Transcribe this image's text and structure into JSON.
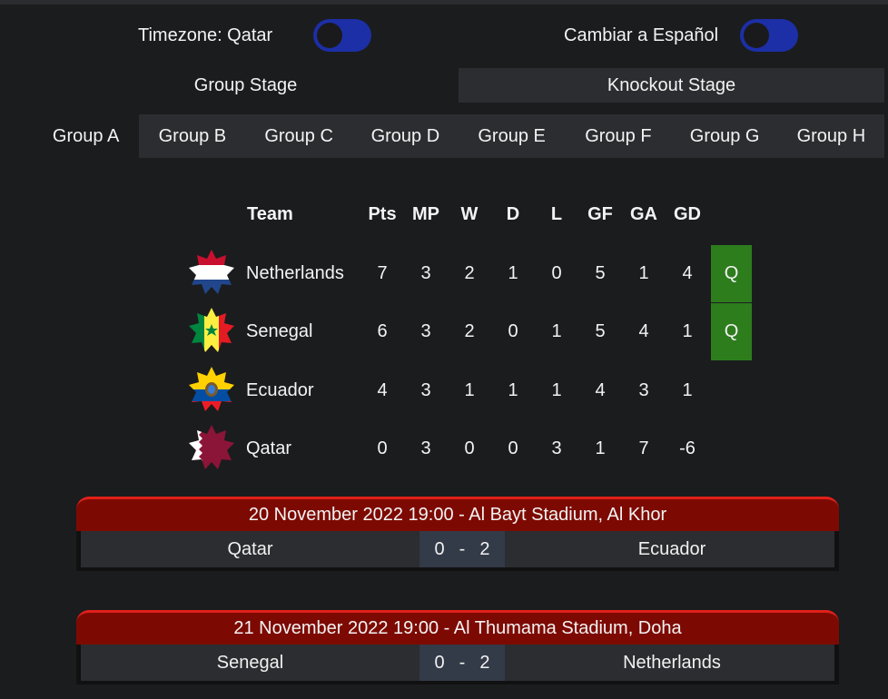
{
  "settings": {
    "timezone_label": "Timezone: Qatar",
    "language_label": "Cambiar a Español"
  },
  "stage_tabs": [
    "Group Stage",
    "Knockout Stage"
  ],
  "group_tabs": [
    "Group A",
    "Group B",
    "Group C",
    "Group D",
    "Group E",
    "Group F",
    "Group G",
    "Group H"
  ],
  "table": {
    "headers": [
      "Team",
      "Pts",
      "MP",
      "W",
      "D",
      "L",
      "GF",
      "GA",
      "GD"
    ],
    "rows": [
      {
        "team": "Netherlands",
        "stats": [
          "7",
          "3",
          "2",
          "1",
          "0",
          "5",
          "1",
          "4"
        ],
        "status": "Q"
      },
      {
        "team": "Senegal",
        "stats": [
          "6",
          "3",
          "2",
          "0",
          "1",
          "5",
          "4",
          "1"
        ],
        "status": "Q"
      },
      {
        "team": "Ecuador",
        "stats": [
          "4",
          "3",
          "1",
          "1",
          "1",
          "4",
          "3",
          "1"
        ],
        "status": ""
      },
      {
        "team": "Qatar",
        "stats": [
          "0",
          "3",
          "0",
          "0",
          "3",
          "1",
          "7",
          "-6"
        ],
        "status": ""
      }
    ]
  },
  "matches": [
    {
      "header": "20 November 2022 19:00 - Al Bayt Stadium, Al Khor",
      "home": "Qatar",
      "home_score": "0",
      "separator": "-",
      "away_score": "2",
      "away": "Ecuador"
    },
    {
      "header": "21 November 2022 19:00 - Al Thumama Stadium, Doha",
      "home": "Senegal",
      "home_score": "0",
      "separator": "-",
      "away_score": "2",
      "away": "Netherlands"
    }
  ],
  "colors": {
    "background": "#1b1c1e",
    "toggle": "#1c2fa6",
    "qualified": "#2d7d1d",
    "match_header": "#7d0a02",
    "score_bg": "#333a48"
  }
}
